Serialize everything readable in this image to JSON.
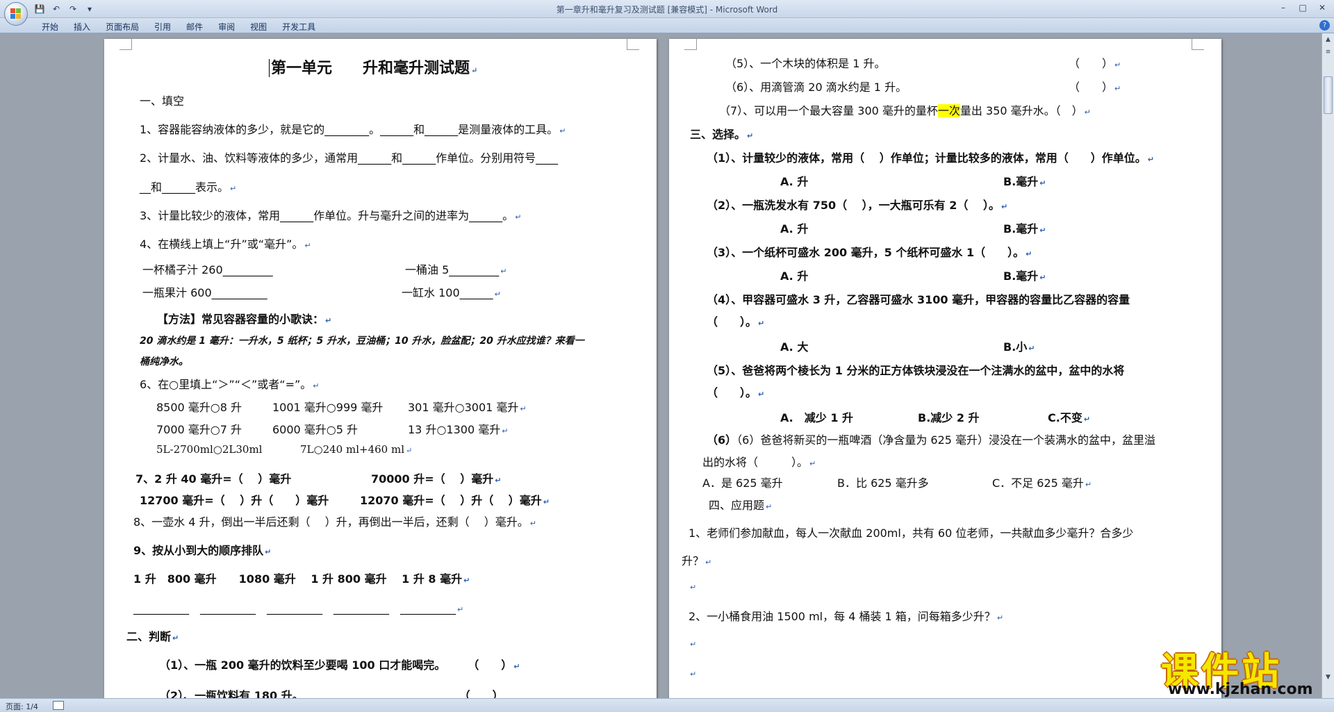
{
  "window": {
    "title": "第一章升和毫升复习及测试题 [兼容模式] - Microsoft Word",
    "minimize": "–",
    "maximize": "□",
    "close": "✕"
  },
  "qat": {
    "save": "💾",
    "undo": "↶",
    "redo": "↷",
    "more": "▾"
  },
  "tabs": [
    "开始",
    "插入",
    "页面布局",
    "引用",
    "邮件",
    "审阅",
    "视图",
    "开发工具"
  ],
  "help": "?",
  "status": {
    "page": "页面: 1/4"
  },
  "watermark": {
    "text": "课件站",
    "url": "www.kjzhan.com"
  },
  "paragraph_mark": "↵",
  "left_page": {
    "title": "第一单元　　升和毫升测试题",
    "s1": "一、填空",
    "q1": "1、容器能容纳液体的多少，就是它的________。______和______是测量液体的工具。",
    "q2a": "2、计量水、油、饮料等液体的多少，通常用______和______作单位。分别用符号____",
    "q2b": "__和______表示。",
    "q3": "3、计量比较少的液体，常用______作单位。升与毫升之间的进率为______。",
    "q4": "4、在横线上填上“升”或“毫升”。",
    "q4a": "一杯橘子汁 260_________",
    "q4b": "一桶油 5_________",
    "q4c": "一瓶果汁 600__________",
    "q4d": "一缸水 100______",
    "method_title": "【方法】常见容器容量的小歌诀：",
    "method_1": "20 滴水约是 1 毫升：一升水，5 纸杯；5 升水，豆油桶；10 升水，脸盆配；20 升水应找谁？来看一",
    "method_2": "桶纯净水。",
    "q6": "6、在○里填上“＞”“＜”或者“=”。",
    "q6a": "8500 毫升○8 升",
    "q6b": "1001 毫升○999 毫升",
    "q6c": "301 毫升○3001 毫升",
    "q6d": "7000 毫升○7 升",
    "q6e": "6000 毫升○5 升",
    "q6f": "13 升○1300 毫升",
    "q6g": "5L-2700ml○2L30ml",
    "q6h": "7L○240 ml+460 ml",
    "q7a": "7、2 升 40 毫升=（　 ）毫升",
    "q7b": "70000 升=（　 ）毫升",
    "q7c": "12700 毫升=（　 ）升（　　）毫升",
    "q7d": "12070 毫升=（　 ）升（　 ）毫升",
    "q8": "8、一壶水 4 升，倒出一半后还剩（　 ）升，再倒出一半后，还剩（　 ）毫升。",
    "q9": "9、按从小到大的顺序排队",
    "q9a": "1 升　800 毫升　　1080 毫升　 1 升 800 毫升　 1 升 8 毫升",
    "q9b": "__________　__________　__________　__________　__________",
    "s2": "二、判断",
    "j1": "（1）、一瓶 200 毫升的饮料至少要喝 100 口才能喝完。　　　（　　）",
    "j2": "（2）、一瓶饮料有 180 升。　　　　　　　　　　　　　　　（　　）"
  },
  "right_page": {
    "j5": "（5）、一个木块的体积是 1 升。",
    "j5p": "（　　）",
    "j6": "（6）、用滴管滴 20 滴水约是 1 升。",
    "j6p": "（　　）",
    "j7a": "（7）、可以用一个最大容量 300 毫升的量杯",
    "j7h": "一次",
    "j7b": "量出 350 毫升水。（　）",
    "s3": "三、选择。",
    "c1": "（1）、计量较少的液体，常用（　 ）作单位；计量比较多的液体，常用（　　）作单位。",
    "c1a": "A.  升",
    "c1b": "B.毫升",
    "c2": "（2）、一瓶洗发水有 750（　 ），一大瓶可乐有 2（　 ）。",
    "c2a": "A.  升",
    "c2b": "B.毫升",
    "c3": "（3）、一个纸杯可盛水 200 毫升，5 个纸杯可盛水 1（　　）。",
    "c3a": "A.  升",
    "c3b": "B.毫升",
    "c4": "（4）、甲容器可盛水 3 升，乙容器可盛水 3100 毫升，甲容器的容量比乙容器的容量",
    "c4b": "（　　）。",
    "c4oa": "A.  大",
    "c4ob": "B.小",
    "c5": "（5）、爸爸将两个棱长为 1 分米的正方体铁块浸没在一个注满水的盆中，盆中的水将",
    "c5b": "（　　）。",
    "c5oa": "A.　减少 1 升",
    "c5ob": "B.减少 2 升",
    "c5oc": "C.不变",
    "c6": "（6）爸爸将新买的一瓶啤酒（净含量为 625 毫升）浸没在一个装满水的盆中，盆里溢",
    "c6b": "出的水将（　　　）。",
    "c6oa": "A．是 625 毫升",
    "c6ob": "B．比 625 毫升多",
    "c6oc": "C．不足 625 毫升",
    "s4": "四、应用题",
    "a1": "1、老师们参加献血，每人一次献血 200ml，共有 60 位老师，一共献血多少毫升？合多少",
    "a1b": "升？",
    "a2": "2、一小桶食用油 1500 ml，每 4 桶装 1 箱，问每箱多少升？"
  }
}
